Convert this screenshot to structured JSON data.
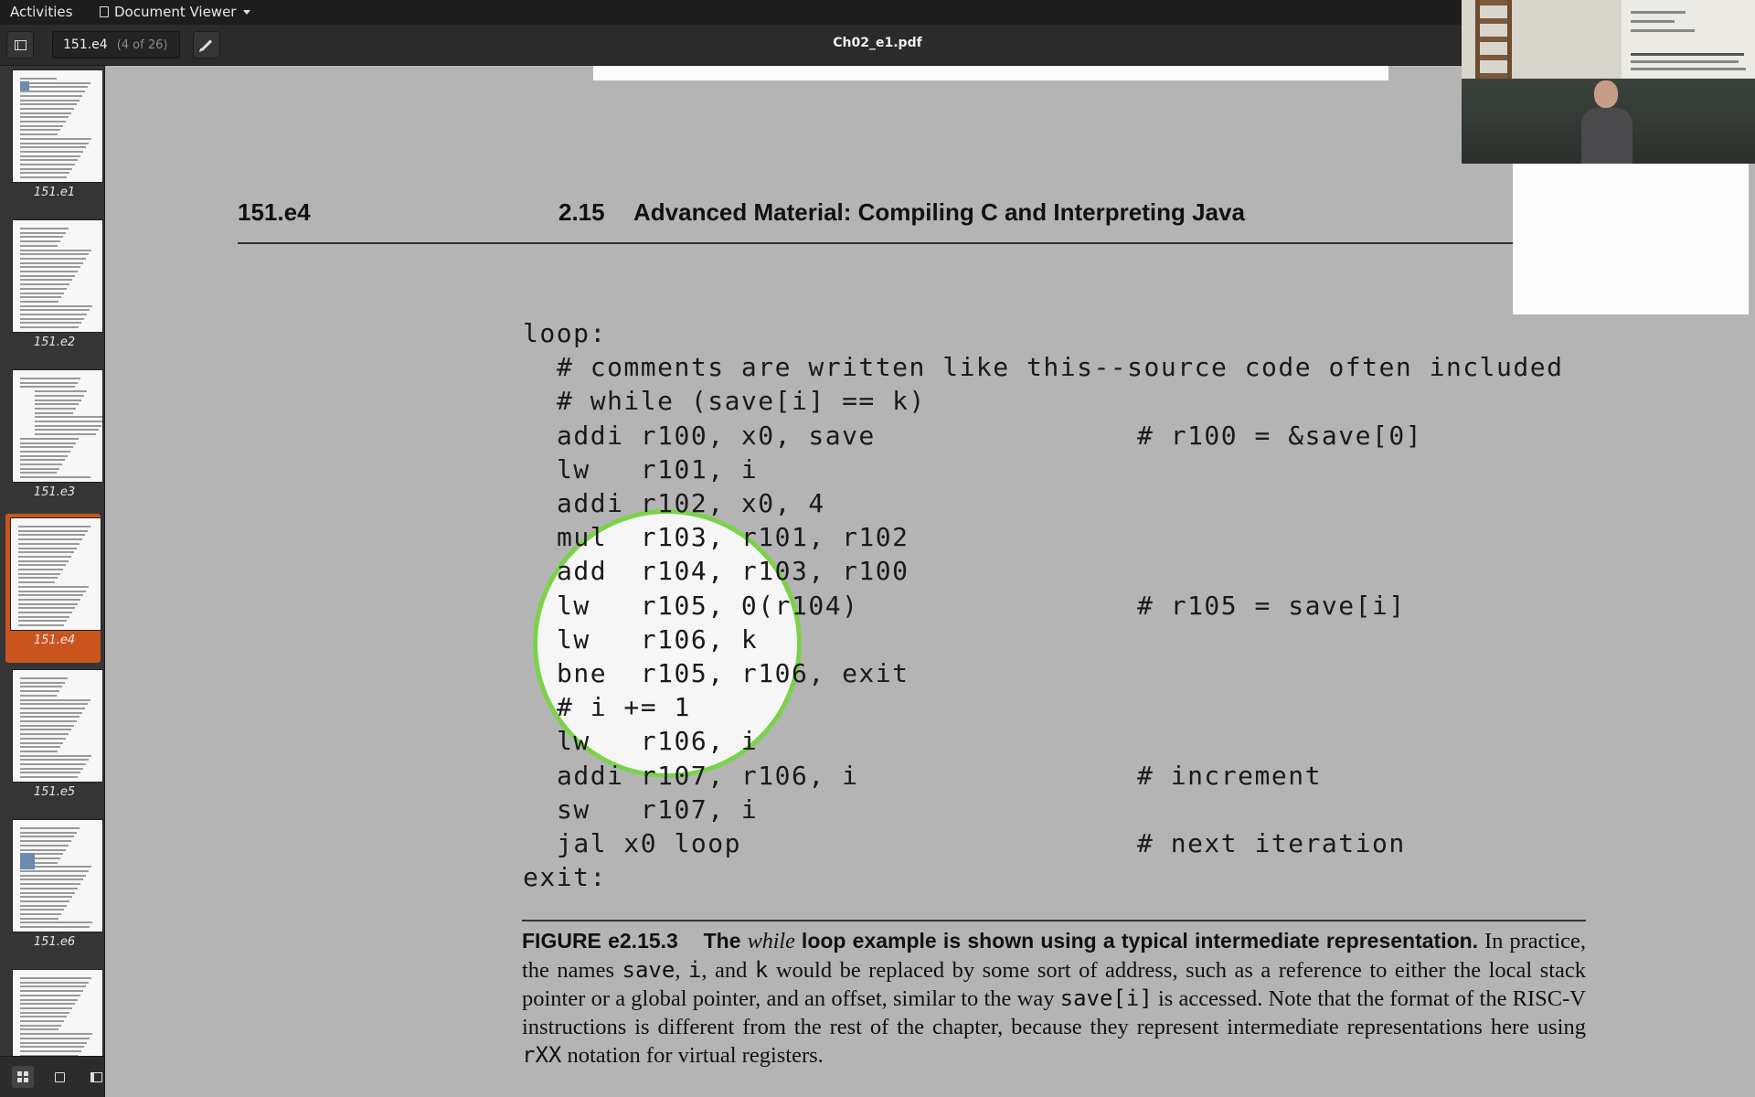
{
  "topbar": {
    "activities": "Activities",
    "app_menu": "Document Viewer"
  },
  "header": {
    "page_label": "151.e4",
    "page_count": "(4 of 26)",
    "title": "Ch02_e1.pdf"
  },
  "sidebar": {
    "thumbnails": [
      {
        "label": "151.e1",
        "selected": false
      },
      {
        "label": "151.e2",
        "selected": false
      },
      {
        "label": "151.e3",
        "selected": false
      },
      {
        "label": "151.e4",
        "selected": true
      },
      {
        "label": "151.e5",
        "selected": false
      },
      {
        "label": "151.e6",
        "selected": false
      },
      {
        "label": "",
        "selected": false
      }
    ],
    "accent": "#c9541e"
  },
  "page": {
    "number": "151.e4",
    "section_no": "2.15",
    "section_title": "Advanced Material: Compiling C and Interpreting Java",
    "code_lines": [
      {
        "indent": 0,
        "text": "loop:",
        "comment": ""
      },
      {
        "indent": 1,
        "text": "# comments are written like this--source code often included",
        "comment": ""
      },
      {
        "indent": 1,
        "text": "# while (save[i] == k)",
        "comment": ""
      },
      {
        "indent": 1,
        "text": "addi r100, x0, save",
        "comment": "# r100 = &save[0]"
      },
      {
        "indent": 1,
        "text": "lw   r101, i",
        "comment": ""
      },
      {
        "indent": 1,
        "text": "addi r102, x0, 4",
        "comment": ""
      },
      {
        "indent": 1,
        "text": "mul  r103, r101, r102",
        "comment": ""
      },
      {
        "indent": 1,
        "text": "add  r104, r103, r100",
        "comment": ""
      },
      {
        "indent": 1,
        "text": "lw   r105, 0(r104)",
        "comment": "# r105 = save[i]"
      },
      {
        "indent": 1,
        "text": "lw   r106, k",
        "comment": ""
      },
      {
        "indent": 1,
        "text": "bne  r105, r106, exit",
        "comment": ""
      },
      {
        "indent": 1,
        "text": "# i += 1",
        "comment": ""
      },
      {
        "indent": 1,
        "text": "lw   r106, i",
        "comment": ""
      },
      {
        "indent": 1,
        "text": "addi r107, r106, i",
        "comment": "# increment"
      },
      {
        "indent": 1,
        "text": "sw   r107, i",
        "comment": ""
      },
      {
        "indent": 1,
        "text": "jal x0 loop",
        "comment": "# next iteration"
      },
      {
        "indent": 0,
        "text": "exit:",
        "comment": ""
      }
    ],
    "caption": {
      "figure": "FIGURE e2.15.3",
      "bold_a": "The ",
      "bold_italic": "while",
      "bold_b": " loop example is shown using a typical intermediate representation.",
      "p1": " In practice, the names ",
      "m1": "save",
      "p2": ", ",
      "m2": "i",
      "p3": ", and ",
      "m3": "k",
      "p4": " would be replaced by some sort of address, such as a reference to either the local stack pointer or a global pointer, and an offset, similar to the way ",
      "m4": "save[i]",
      "p5": " is accessed. Note that the format of the RISC-V instructions is different from the rest of the chapter, because they represent intermediate representations here using ",
      "m5": "rXX",
      "p6": " notation for virtual registers."
    }
  },
  "magnifier_color": "#7bd24a"
}
